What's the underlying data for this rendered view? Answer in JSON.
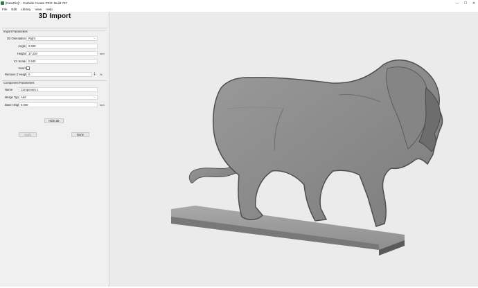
{
  "window": {
    "title": "[NewFile]* - Carbide Create PRO: Build 757",
    "minimize": "—",
    "maximize": "☐",
    "close": "✕"
  },
  "menu": [
    "File",
    "Edit",
    "Library",
    "View",
    "Help"
  ],
  "panel": {
    "title": "3D Import",
    "import_group": {
      "title": "Import Parameters",
      "orientation_label": "3D Orientation",
      "orientation_value": "Right",
      "angle_label": "Angle",
      "angle_value": "0.000",
      "height_label": "Height",
      "height_value": "37.230",
      "height_unit": "mm",
      "xyscale_label": "XY Scale",
      "xyscale_value": "0.540",
      "invert_label": "Invert",
      "removez_label": "Remove Z Height",
      "removez_value": "0",
      "removez_unit": "%"
    },
    "component_group": {
      "title": "Component Parameters",
      "name_label": "Name",
      "name_value": "Component 1",
      "merge_label": "Merge Type",
      "merge_value": "Add",
      "base_label": "Base Height",
      "base_value": "0.000",
      "base_unit": "mm"
    },
    "hide3d_label": "Hide 3D",
    "apply_label": "Apply",
    "done_label": "Done"
  },
  "viewport": {
    "model": "lion-3d-model",
    "background": "#ebebeb",
    "model_color": "#8a8a8a"
  }
}
